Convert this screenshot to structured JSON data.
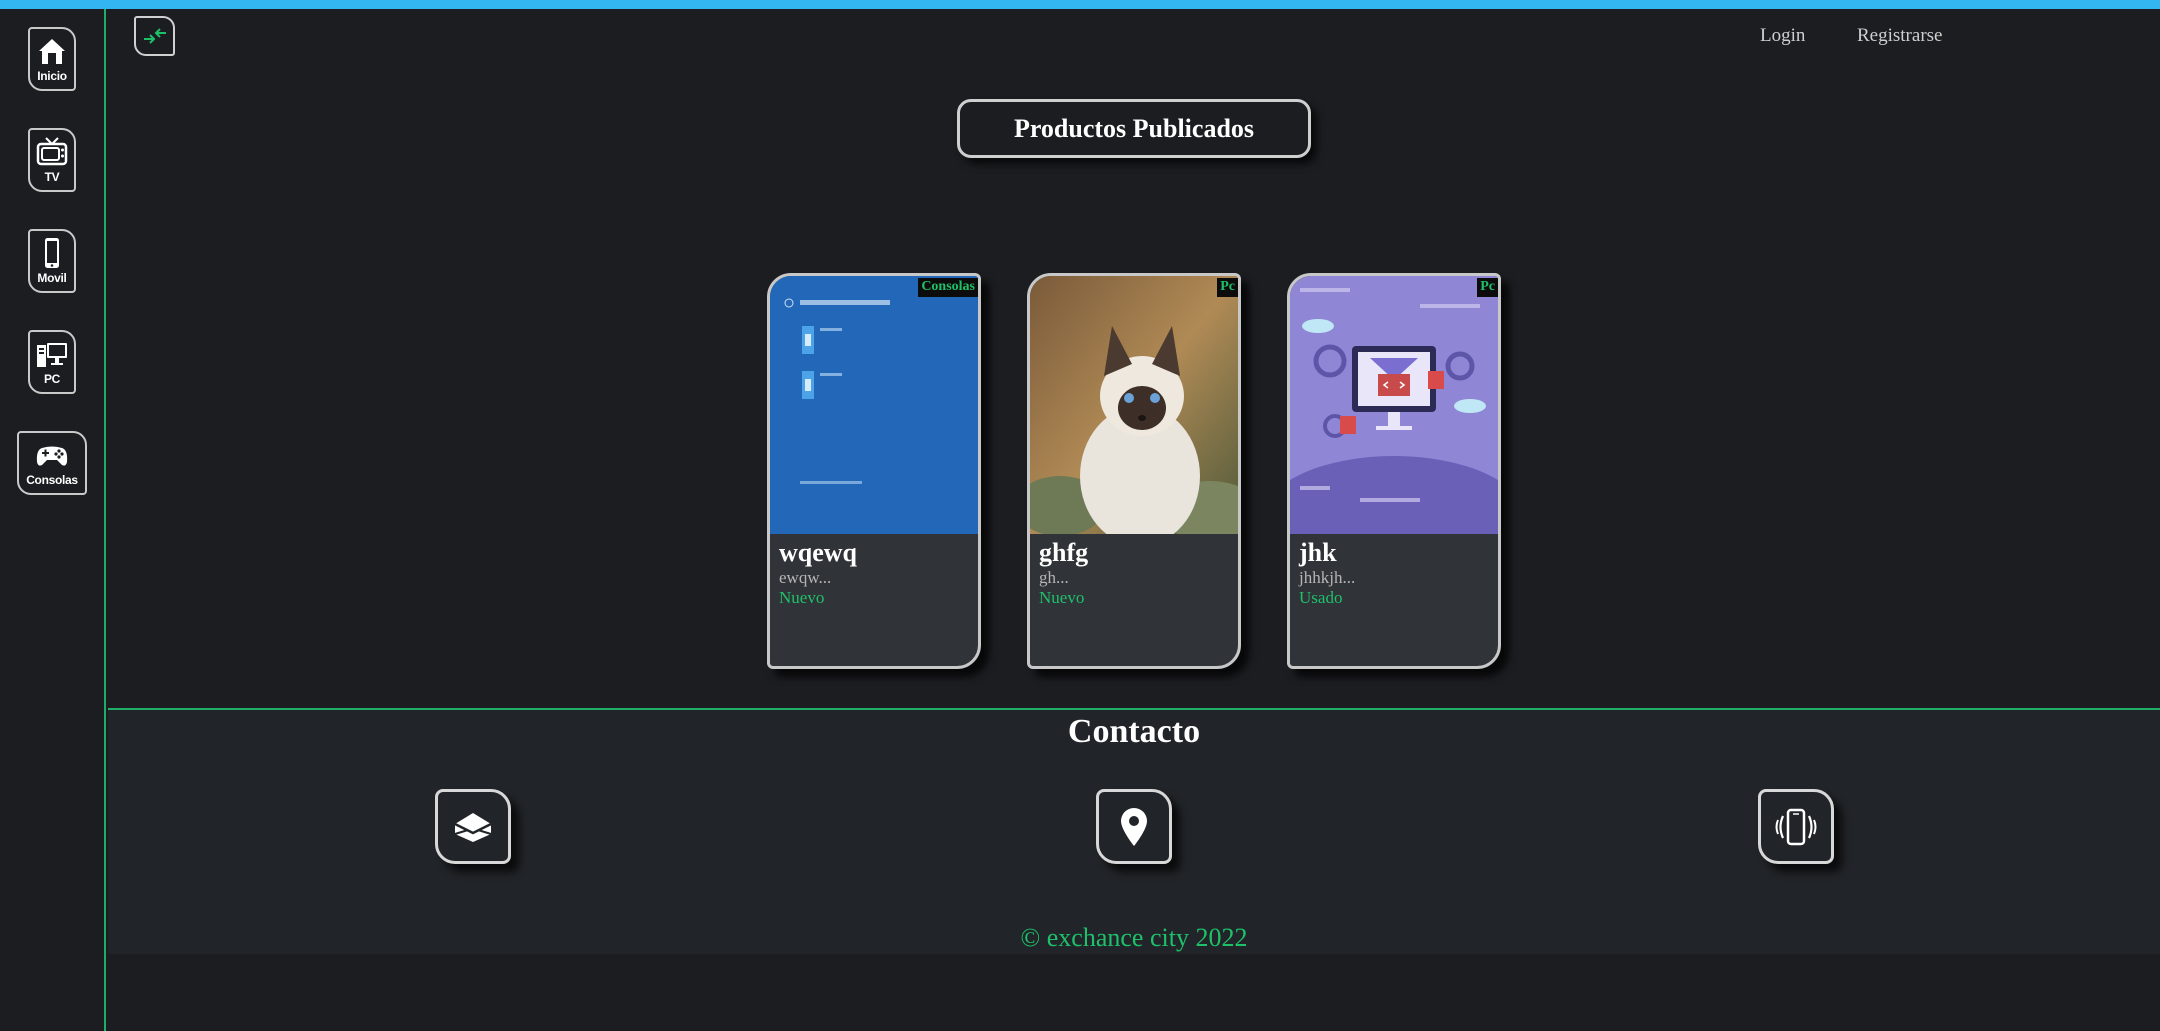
{
  "sidebar": {
    "items": [
      {
        "label": "Inicio",
        "icon": "home-icon"
      },
      {
        "label": "TV",
        "icon": "tv-icon"
      },
      {
        "label": "Movil",
        "icon": "mobile-icon"
      },
      {
        "label": "PC",
        "icon": "pc-icon"
      },
      {
        "label": "Consolas",
        "icon": "gamepad-icon"
      }
    ]
  },
  "header": {
    "collapse_icon": "collapse-arrows-icon",
    "login_label": "Login",
    "register_label": "Registrarse"
  },
  "main": {
    "title": "Productos Publicados",
    "products": [
      {
        "name": "wqewq",
        "description": "ewqw...",
        "condition": "Nuevo",
        "category": "Consolas",
        "image": "windows-os-screen"
      },
      {
        "name": "ghfg",
        "description": "gh...",
        "condition": "Nuevo",
        "category": "Pc",
        "image": "cat-photo"
      },
      {
        "name": "jhk",
        "description": "jhhkjh...",
        "condition": "Usado",
        "category": "Pc",
        "image": "coding-illustration"
      }
    ]
  },
  "footer": {
    "contact_title": "Contacto",
    "contact_icons": [
      "mail-icon",
      "location-pin-icon",
      "phone-vibrate-icon"
    ],
    "copyright": "© exchance city 2022"
  },
  "colors": {
    "accent": "#1fc06a",
    "topbar": "#33b5f2",
    "background": "#1b1d20",
    "card": "#303338"
  }
}
